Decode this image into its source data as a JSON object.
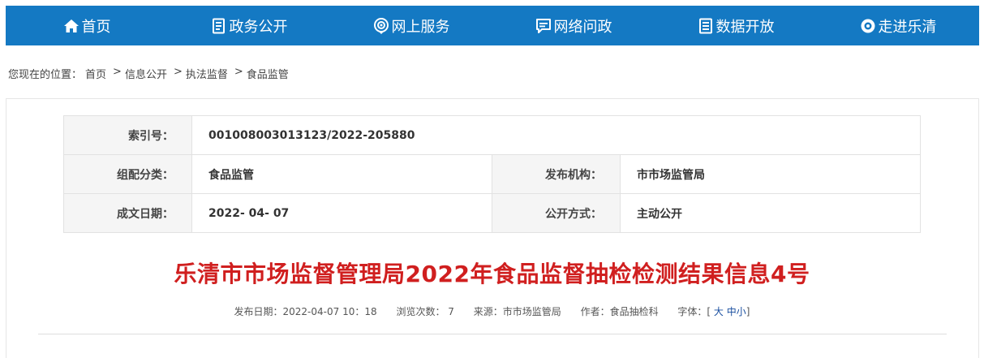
{
  "nav": {
    "items": [
      {
        "label": "首页",
        "icon": "home-icon"
      },
      {
        "label": "政务公开",
        "icon": "document-icon"
      },
      {
        "label": "网上服务",
        "icon": "service-icon"
      },
      {
        "label": "网络问政",
        "icon": "chat-icon"
      },
      {
        "label": "数据开放",
        "icon": "data-icon"
      },
      {
        "label": "走进乐清",
        "icon": "eye-icon"
      }
    ],
    "color": "#1479c3"
  },
  "breadcrumb": {
    "prefix": "您现在的位置：",
    "items": [
      "首页",
      "信息公开",
      "执法监督",
      "食品监管"
    ],
    "separator": ">"
  },
  "meta": {
    "index_label": "索引号：",
    "index_value": "001008003013123/2022-205880",
    "category_label": "组配分类：",
    "category_value": "食品监管",
    "publisher_label": "发布机构：",
    "publisher_value": "市市场监管局",
    "date_label": "成文日期：",
    "date_value": "2022- 04- 07",
    "method_label": "公开方式：",
    "method_value": "主动公开"
  },
  "article": {
    "title": "乐清市市场监督管理局2022年食品监督抽检检测结果信息4号",
    "title_color": "#d01f1f",
    "publish_date": "发布日期：2022-04-07 10：18",
    "views": "浏览次数： 7",
    "source": "来源：市市场监管局",
    "author": "作者：食品抽检科",
    "font_size_label": "字体：[",
    "font_large": "大",
    "font_medium": "中",
    "font_small": "小",
    "font_size_close": "]"
  }
}
